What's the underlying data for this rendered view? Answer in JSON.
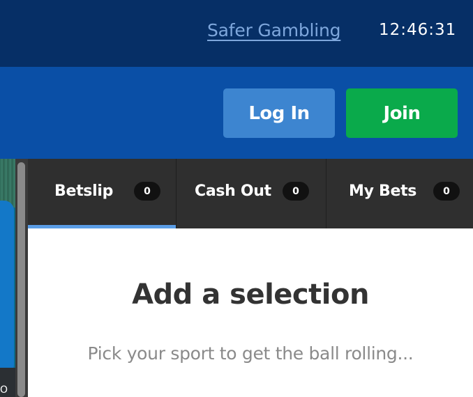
{
  "topbar": {
    "safer_gambling_link": "Safer Gambling",
    "clock": "12:46:31"
  },
  "header": {
    "login_label": "Log In",
    "join_label": "Join"
  },
  "video": {
    "caption": "O"
  },
  "betslip_tabs": [
    {
      "label": "Betslip",
      "count": "0",
      "active": true
    },
    {
      "label": "Cash Out",
      "count": "0",
      "active": false
    },
    {
      "label": "My Bets",
      "count": "0",
      "active": false
    }
  ],
  "betslip_empty": {
    "title": "Add a selection",
    "subtitle": "Pick your sport to get the ball rolling..."
  },
  "colors": {
    "topbar_bg": "#062f66",
    "header_bg": "#0a4fa6",
    "login_bg": "#3d85d0",
    "join_bg": "#0aaa4b",
    "tab_bg": "#2f2f2f",
    "active_tab_indicator": "#5b9ee6"
  }
}
